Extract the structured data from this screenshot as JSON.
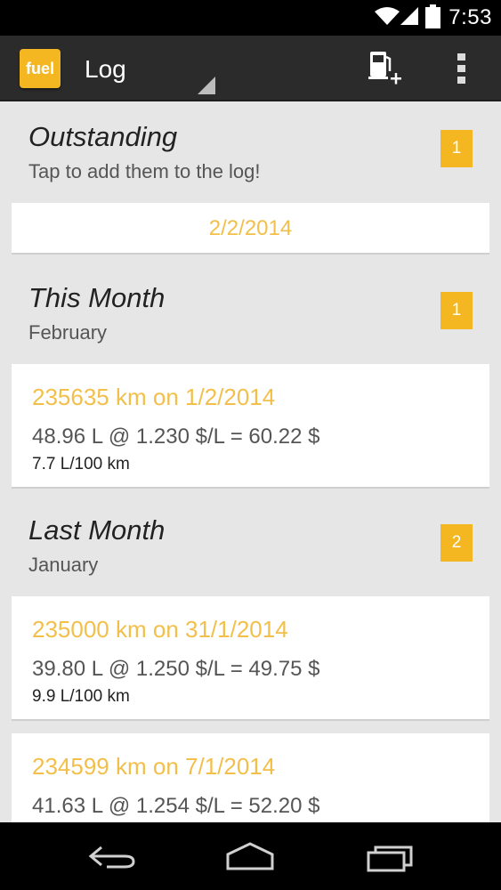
{
  "status_bar": {
    "time": "7:53"
  },
  "action_bar": {
    "app_icon_text": "fuel",
    "title": "Log"
  },
  "sections": {
    "outstanding": {
      "title": "Outstanding",
      "subtitle": "Tap to add them to the log!",
      "count": "1",
      "dates": [
        "2/2/2014"
      ]
    },
    "this_month": {
      "title": "This Month",
      "subtitle": "February",
      "count": "1"
    },
    "last_month": {
      "title": "Last Month",
      "subtitle": "January",
      "count": "2"
    }
  },
  "entries": [
    {
      "title": "235635 km on 1/2/2014",
      "calc": "48.96 L @ 1.230 $/L = 60.22 $",
      "efficiency": "7.7 L/100 km"
    },
    {
      "title": "235000 km on 31/1/2014",
      "calc": "39.80 L @ 1.250 $/L = 49.75 $",
      "efficiency": "9.9 L/100 km"
    },
    {
      "title": "234599 km on 7/1/2014",
      "calc": "41.63 L @ 1.254 $/L = 52.20 $",
      "efficiency": ""
    }
  ],
  "colors": {
    "accent": "#f4b721",
    "entry_title": "#f2c04a",
    "action_bar": "#2b2b2b",
    "background": "#e6e6e6"
  },
  "icons": {
    "wifi": "wifi-icon",
    "signal": "signal-icon",
    "battery": "battery-icon",
    "add_fuel": "fuel-pump-add-icon",
    "overflow": "overflow-menu-icon",
    "back": "back-icon",
    "home": "home-icon",
    "recents": "recents-icon"
  }
}
